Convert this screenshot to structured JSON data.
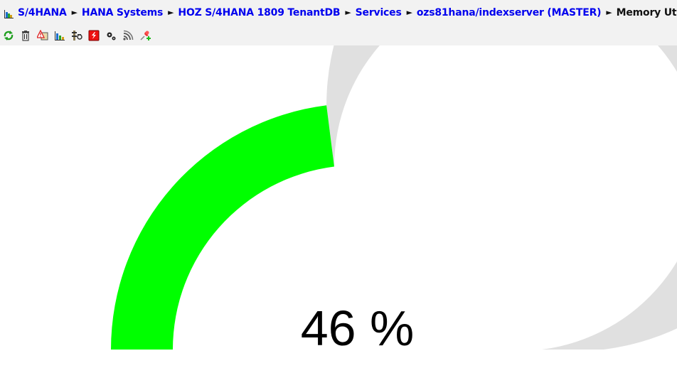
{
  "breadcrumb": {
    "home_icon": "hierarchy-chart-icon",
    "separator": "►",
    "items": [
      {
        "label": "S/4HANA",
        "link": true
      },
      {
        "label": "HANA Systems",
        "link": true
      },
      {
        "label": "HOZ S/4HANA 1809 TenantDB",
        "link": true
      },
      {
        "label": "Services",
        "link": true
      },
      {
        "label": "ozs81hana/indexserver (MASTER)",
        "link": true
      },
      {
        "label": "Memory Utilization",
        "link": false
      }
    ]
  },
  "toolbar": {
    "buttons": [
      {
        "icon": "refresh-icon",
        "title": "Refresh"
      },
      {
        "icon": "trash-icon",
        "title": "Delete"
      },
      {
        "icon": "alert-config-icon",
        "title": "Alerts"
      },
      {
        "icon": "bar-chart-icon",
        "title": "Chart"
      },
      {
        "icon": "tools-icon",
        "title": "Tools"
      },
      {
        "icon": "flash-icon",
        "title": "Flash"
      },
      {
        "icon": "gears-icon",
        "title": "Settings"
      },
      {
        "icon": "signal-icon",
        "title": "Signal"
      },
      {
        "icon": "pin-add-icon",
        "title": "Pin"
      }
    ]
  },
  "gauge": {
    "metric": "Memory Utilization",
    "value_percent": 46,
    "display": "46 %",
    "min": 0,
    "max": 100,
    "fill_color": "#00ff00",
    "track_color": "#e0e0e0"
  }
}
